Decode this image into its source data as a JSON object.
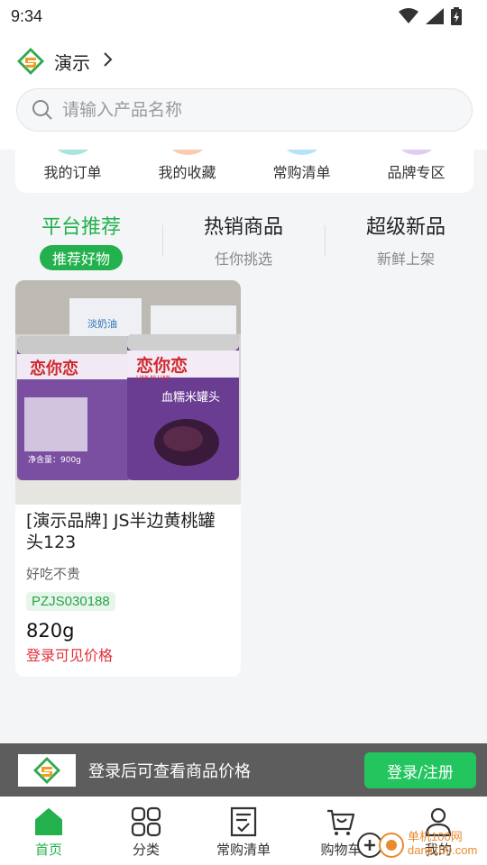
{
  "status_bar": {
    "time": "9:34"
  },
  "header": {
    "brand_name": "演示",
    "search_placeholder": "请输入产品名称"
  },
  "quick_menu": [
    {
      "label": "我的订单",
      "color": "#5fd0c2"
    },
    {
      "label": "我的收藏",
      "color": "#f5a26a"
    },
    {
      "label": "常购清单",
      "color": "#76cdf0"
    },
    {
      "label": "品牌专区",
      "color": "#c9a4e8"
    }
  ],
  "tabs": [
    {
      "title": "平台推荐",
      "subtitle": "推荐好物"
    },
    {
      "title": "热销商品",
      "subtitle": "任你挑选"
    },
    {
      "title": "超级新品",
      "subtitle": "新鲜上架"
    }
  ],
  "product": {
    "title": "[演示品牌] JS半边黄桃罐头123",
    "description": "好吃不贵",
    "code": "PZJS030188",
    "weight": "820g",
    "price_notice": "登录可见价格",
    "image": {
      "brand_text": "恋你恋",
      "product_text": "血糯米罐头",
      "latin_text": "LIAN NI LIAN",
      "net_weight": "净含量：900g",
      "box_text": "淡奶油"
    }
  },
  "login_banner": {
    "text": "登录后可查看商品价格",
    "button": "登录/注册"
  },
  "bottom_nav": [
    {
      "label": "首页",
      "icon": "home-icon"
    },
    {
      "label": "分类",
      "icon": "category-grid-icon"
    },
    {
      "label": "常购清单",
      "icon": "list-icon"
    },
    {
      "label": "购物车",
      "icon": "cart-icon"
    },
    {
      "label": "我的",
      "icon": "user-icon"
    }
  ],
  "watermark": {
    "line1": "单机100网",
    "line2": "danji100.com"
  },
  "colors": {
    "accent": "#23b14d",
    "price": "#e0303a",
    "banner": "#5d5d5d",
    "login_button": "#22c55e"
  }
}
